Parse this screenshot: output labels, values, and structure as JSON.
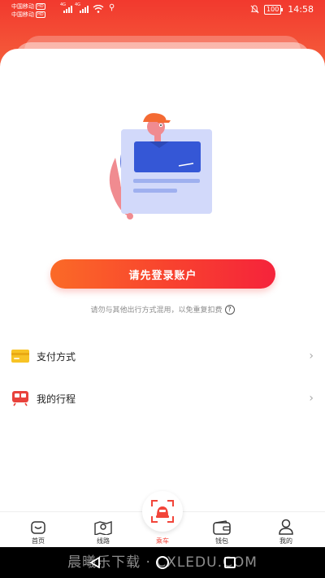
{
  "status_bar": {
    "carrier1": "中国移动",
    "carrier2": "中国移动",
    "hd_badge": "HD",
    "network": "4G",
    "battery": "100",
    "time": "14:58"
  },
  "login": {
    "button_label": "请先登录账户",
    "notice": "请勿与其他出行方式混用，以免重复扣费",
    "help_glyph": "?"
  },
  "menu": [
    {
      "label": "支付方式",
      "icon": "card-icon"
    },
    {
      "label": "我的行程",
      "icon": "train-icon"
    }
  ],
  "tabs": [
    {
      "label": "首页",
      "icon": "home-icon"
    },
    {
      "label": "线路",
      "icon": "map-icon"
    },
    {
      "label": "乘车",
      "icon": "scan-ride-icon",
      "active": true
    },
    {
      "label": "钱包",
      "icon": "wallet-icon"
    },
    {
      "label": "我的",
      "icon": "user-icon"
    }
  ],
  "watermark": "晨曦乐下载 · CXLEDU.COM",
  "colors": {
    "accent": "#f2392e",
    "gradient_start": "#fb6a27",
    "gradient_end": "#f5233b"
  }
}
